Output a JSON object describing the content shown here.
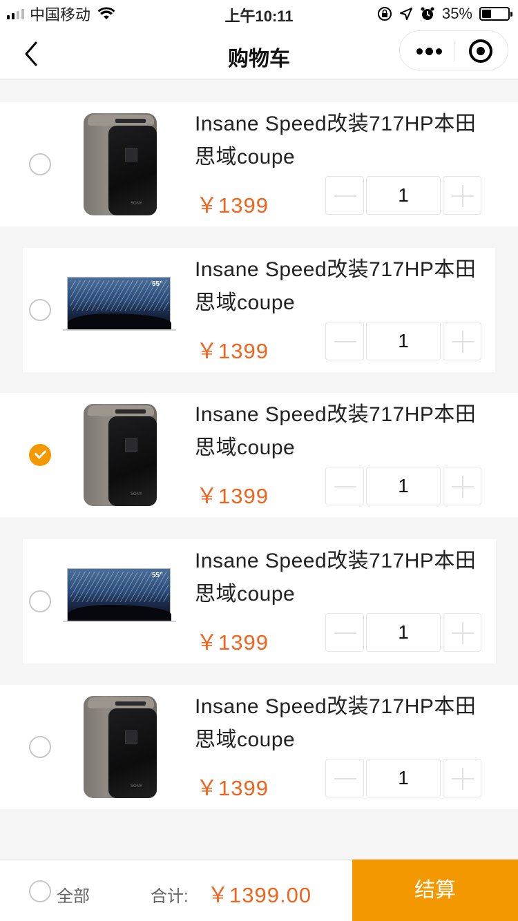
{
  "status_bar": {
    "carrier": "中国移动",
    "time": "上午10:11",
    "battery": "35%",
    "battery_level": 0.35
  },
  "nav": {
    "title": "购物车"
  },
  "items": [
    {
      "title": "Insane Speed改装717HP本田思域coupe",
      "price": "￥1399",
      "quantity": "1",
      "checked": false,
      "image": "projector"
    },
    {
      "title": "Insane Speed改装717HP本田思域coupe",
      "price": "￥1399",
      "quantity": "1",
      "checked": false,
      "image": "tv"
    },
    {
      "title": "Insane Speed改装717HP本田思域coupe",
      "price": "￥1399",
      "quantity": "1",
      "checked": true,
      "image": "projector"
    },
    {
      "title": "Insane Speed改装717HP本田思域coupe",
      "price": "￥1399",
      "quantity": "1",
      "checked": false,
      "image": "tv"
    },
    {
      "title": "Insane Speed改装717HP本田思域coupe",
      "price": "￥1399",
      "quantity": "1",
      "checked": false,
      "image": "projector"
    }
  ],
  "tv_size_label": "55\"",
  "projector_brand": "SONY",
  "footer": {
    "select_all_label": "全部",
    "total_label": "合计:",
    "total_value": "￥1399.00",
    "checkout_label": "结算"
  },
  "colors": {
    "accent": "#f39800",
    "price": "#f0641e"
  }
}
